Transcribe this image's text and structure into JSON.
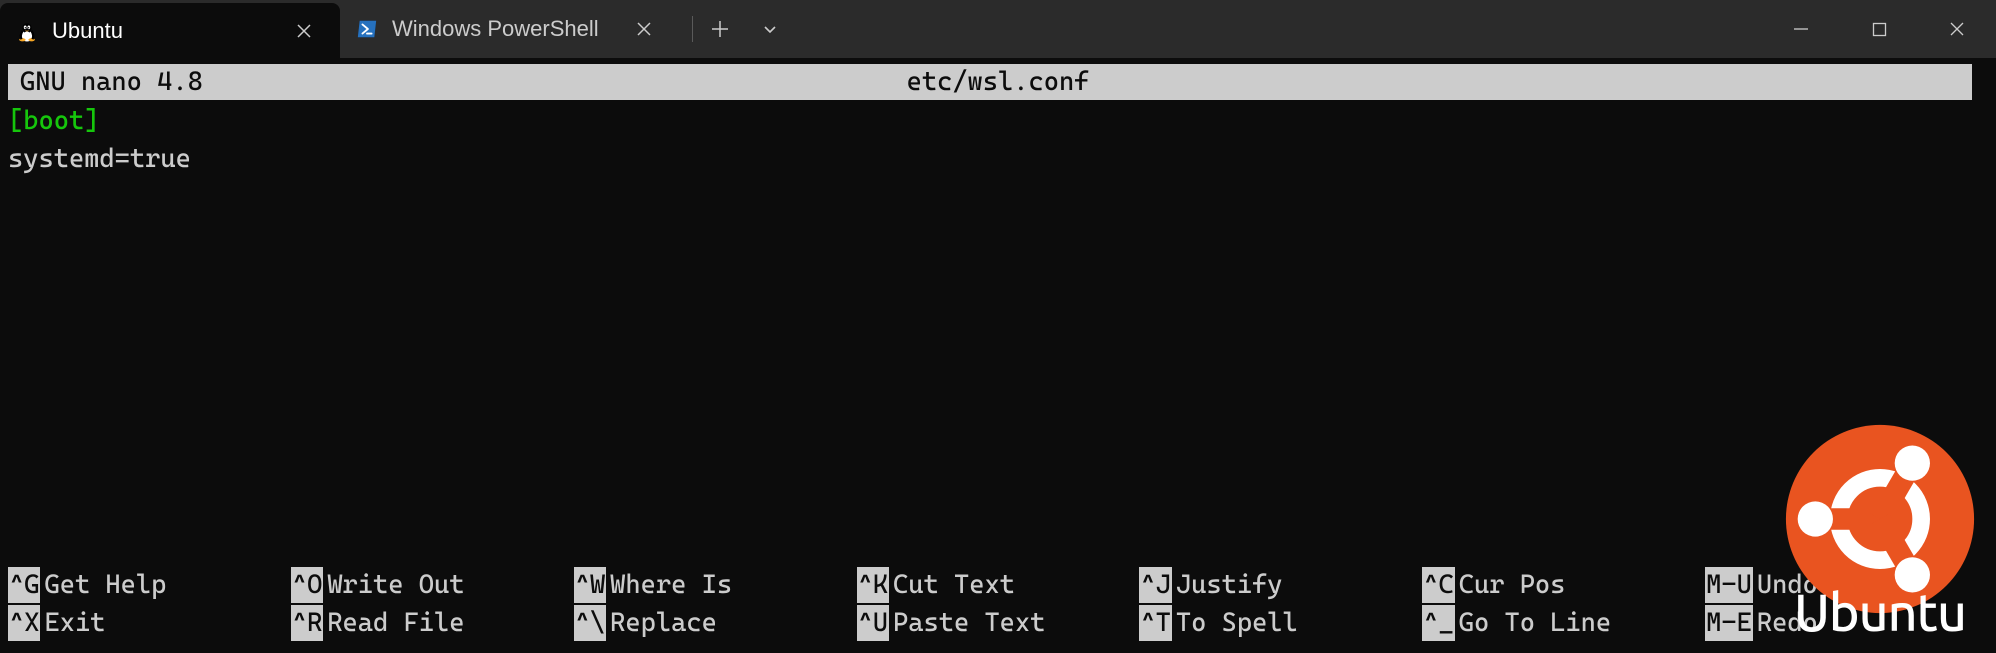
{
  "titlebar": {
    "tabs": [
      {
        "title": "Ubuntu",
        "active": true
      },
      {
        "title": "Windows PowerShell",
        "active": false
      }
    ]
  },
  "nano": {
    "app_name": "GNU nano 4.8",
    "filename": "etc/wsl.conf",
    "content": {
      "section": "[boot]",
      "line1": "systemd=true"
    },
    "shortcuts": [
      {
        "key": "^G",
        "label": "Get Help"
      },
      {
        "key": "^O",
        "label": "Write Out"
      },
      {
        "key": "^W",
        "label": "Where Is"
      },
      {
        "key": "^K",
        "label": "Cut Text"
      },
      {
        "key": "^J",
        "label": "Justify"
      },
      {
        "key": "^C",
        "label": "Cur Pos"
      },
      {
        "key": "M-U",
        "label": "Undo"
      },
      {
        "key": "^X",
        "label": "Exit"
      },
      {
        "key": "^R",
        "label": "Read File"
      },
      {
        "key": "^\\",
        "label": "Replace"
      },
      {
        "key": "^U",
        "label": "Paste Text"
      },
      {
        "key": "^T",
        "label": "To Spell"
      },
      {
        "key": "^_",
        "label": "Go To Line"
      },
      {
        "key": "M-E",
        "label": "Redo"
      }
    ]
  },
  "watermark": {
    "text": "Ubuntu"
  }
}
